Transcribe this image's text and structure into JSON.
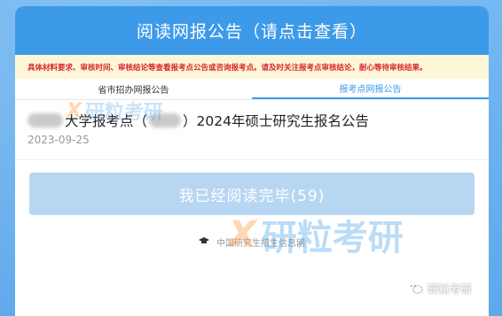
{
  "header": {
    "title": "阅读网报公告（请点击查看）"
  },
  "notice": {
    "text": "具体材料要求、审核时间、审核结论等查看报考点公告或咨询报考点。请及时关注报考点审核结论，耐心等待审核结果。"
  },
  "tabs": [
    {
      "label": "省市招办网报公告"
    },
    {
      "label": "报考点网报公告"
    }
  ],
  "article": {
    "title_part1": "大学报考点（",
    "title_part2": "）2024年硕士研究生报名公告",
    "date": "2023-09-25"
  },
  "read_button": {
    "label": "我已经阅读完毕(59)"
  },
  "footer": {
    "text": "中国研究生招生信息网"
  },
  "watermark": {
    "x": "X",
    "text": "研粒考研"
  },
  "wechat_badge": {
    "text": "研粒考研"
  },
  "colors": {
    "brand": "#3d9ae8",
    "notice_text": "#d9262a",
    "button_disabled": "#b7d6f1"
  },
  "icons": {
    "footer": "graduation-cap-icon",
    "badge": "wechat-icon"
  }
}
